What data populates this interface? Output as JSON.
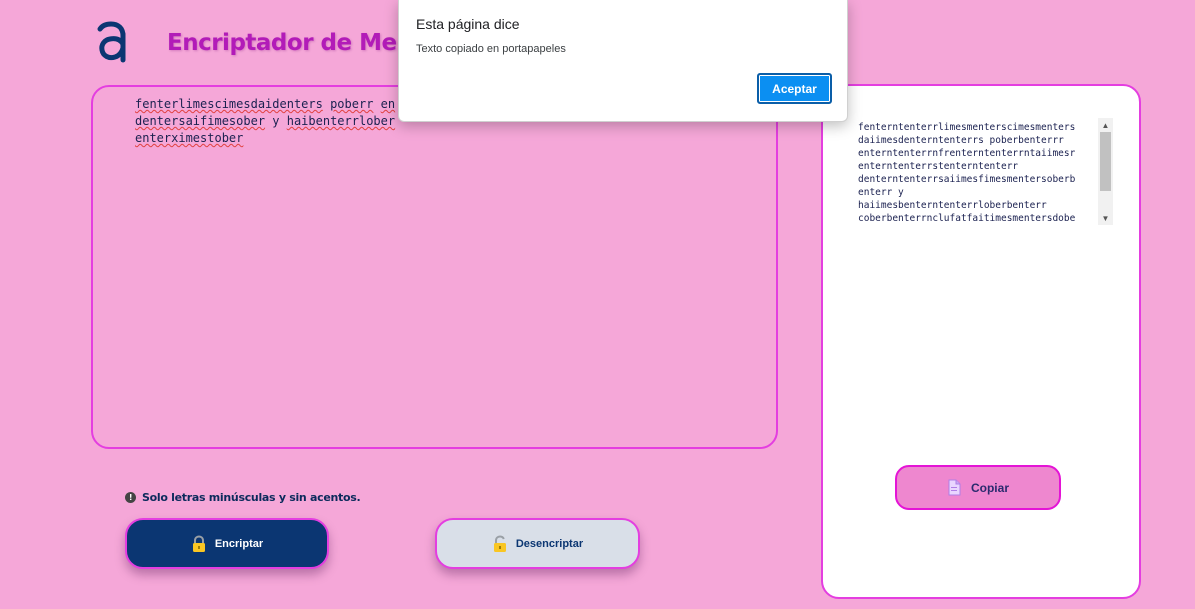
{
  "header": {
    "logo_icon": "alura-a-logo-icon",
    "title": "Encriptador de Mensaj"
  },
  "input": {
    "lines": [
      [
        "fenterlimescimesdaidenters",
        " ",
        "poberr",
        " ",
        "en"
      ],
      [
        "dentersaifimesober",
        " y ",
        "haibenterrlober"
      ],
      [
        "enterximestober"
      ]
    ]
  },
  "hint": {
    "icon": "exclamation-circle-icon",
    "text": "Solo letras minúsculas y sin acentos."
  },
  "buttons": {
    "encrypt_label": "Encriptar",
    "decrypt_label": "Desencriptar",
    "copy_label": "Copiar"
  },
  "output": {
    "text": "fenterntenterrlimesmenterscimesmenters\ndaiimesdenterntenterrs poberbenterrr\nenterntenterrnfrenterntenterrntaiimesr\nenterntenterrstenterntenterr\ndenterntenterrsaiimesfimesmentersoberb\nenterr y\nhaiimesbenterntenterrloberbenterr\ncoberbenterrnclufatfaitimesmentersdobe"
  },
  "dialog": {
    "title": "Esta página dice",
    "message": "Texto copiado en portapapeles",
    "ok_label": "Aceptar"
  },
  "colors": {
    "background": "#f5a7d8",
    "accent": "#e43ee0",
    "title": "#b21bb8",
    "encrypt_button": "#0b3672",
    "decrypt_button": "#d9dfe8",
    "copy_button": "#ee87cf",
    "dialog_button": "#0b8ff2"
  }
}
